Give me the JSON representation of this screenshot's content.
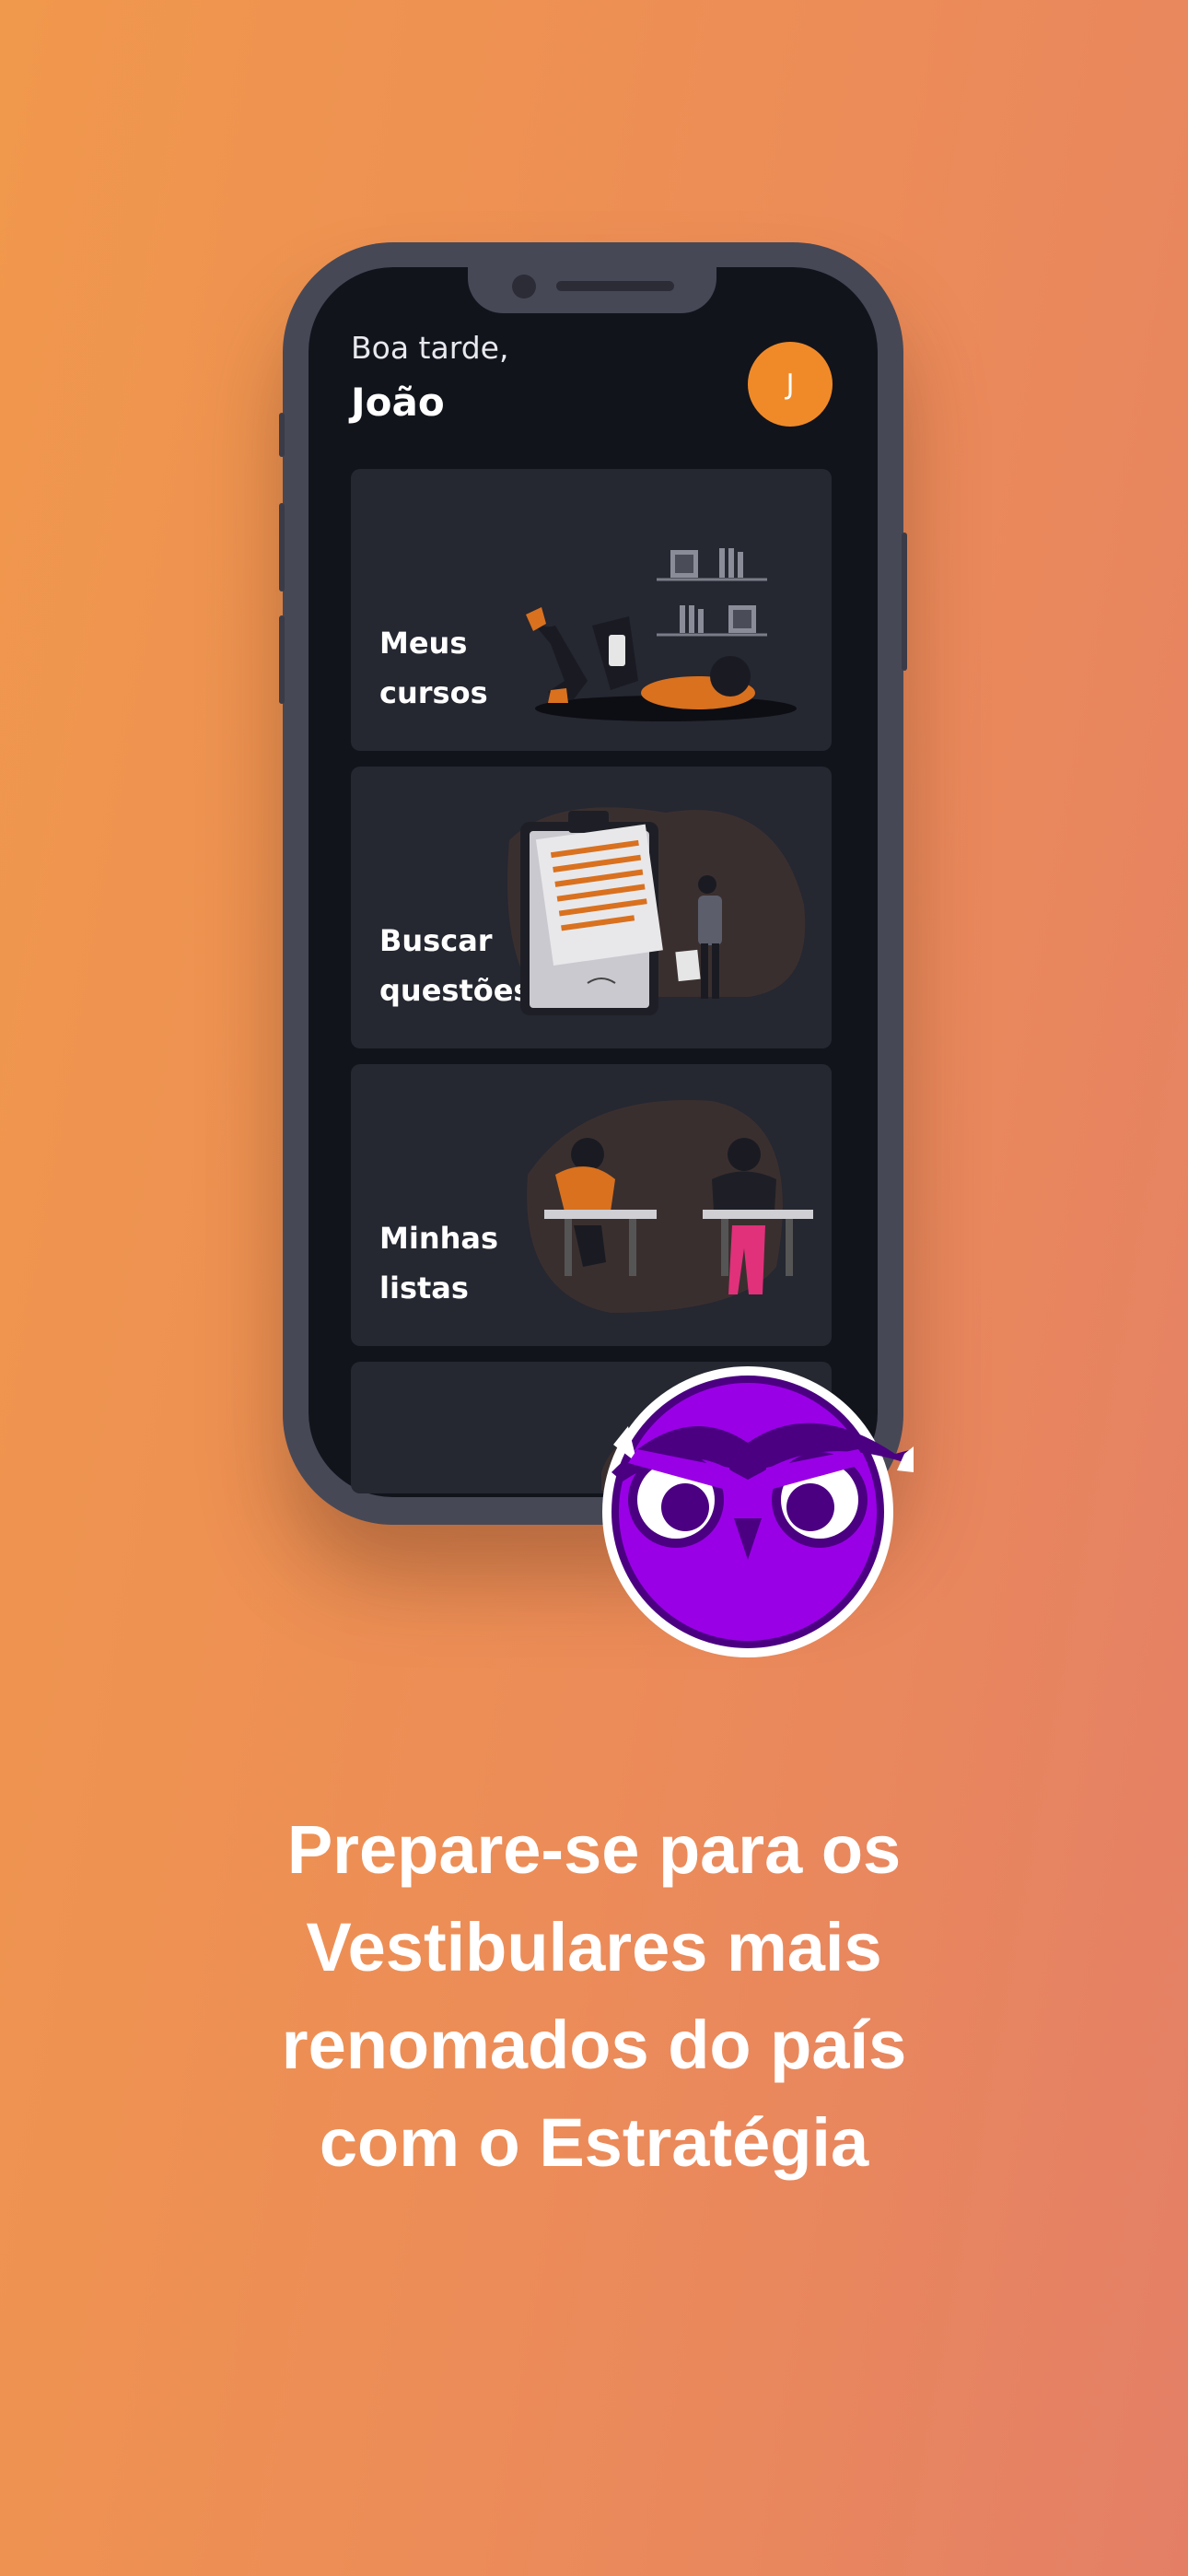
{
  "header": {
    "greeting": "Boa tarde,",
    "user_name": "João",
    "avatar_initial": "J"
  },
  "cards": [
    {
      "line1": "Meus",
      "line2": "cursos",
      "illustration": "reading-person-illustration"
    },
    {
      "line1": "Buscar",
      "line2": "questões",
      "illustration": "clipboard-person-illustration"
    },
    {
      "line1": "Minhas",
      "line2": "listas",
      "illustration": "students-studying-illustration"
    }
  ],
  "mascot": "owl-mascot-icon",
  "tagline": {
    "line1": "Prepare-se para os",
    "line2": "Vestibulares mais",
    "line3": "renomados do país",
    "line4": "com o Estratégia"
  },
  "colors": {
    "accent": "#f08a28",
    "screen_bg": "#12141c",
    "card_bg": "#252731",
    "owl_purple": "#9100e0",
    "background_start": "#f0984c",
    "background_end": "#e47f66"
  }
}
